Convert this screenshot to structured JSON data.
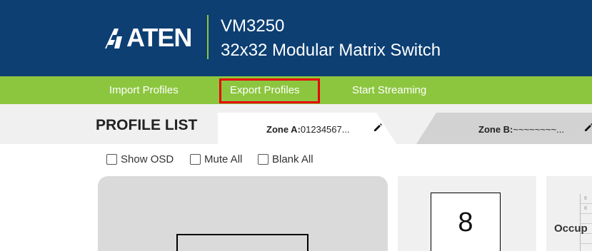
{
  "header": {
    "logo_text": "ATEN",
    "model": "VM3250",
    "product_name": "32x32 Modular Matrix Switch"
  },
  "nav": {
    "items": [
      {
        "label": "Import Profiles"
      },
      {
        "label": "Export Profiles",
        "highlighted": true
      },
      {
        "label": "Start Streaming"
      }
    ]
  },
  "profile_list": {
    "title": "PROFILE LIST",
    "tabs": [
      {
        "prefix": "Zone A:",
        "value": "01234567...",
        "active": true
      },
      {
        "prefix": "Zone B:",
        "value": "~~~~~~~~..."
      }
    ]
  },
  "options": [
    {
      "label": "Show OSD"
    },
    {
      "label": "Mute All"
    },
    {
      "label": "Blank All"
    }
  ],
  "preview": {
    "number": "8",
    "occupancy_label": "Occup",
    "mini_cells": [
      "8",
      "8",
      "",
      "",
      ""
    ]
  },
  "colors": {
    "header_bg": "#0d3f73",
    "nav_bg": "#8cc63f",
    "highlight": "#e8000b"
  },
  "icons": [
    "aten-logo-icon",
    "pencil-icon",
    "checkbox-icon"
  ]
}
